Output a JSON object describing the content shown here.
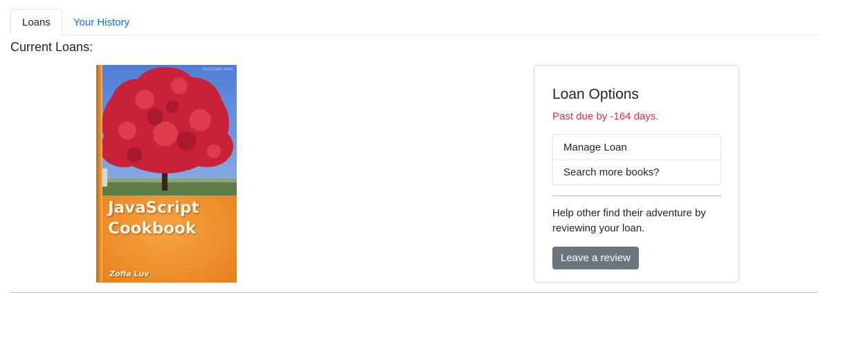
{
  "tabs": [
    {
      "label": "Loans",
      "active": true
    },
    {
      "label": "Your History",
      "active": false
    }
  ],
  "section_title": "Current Loans:",
  "book": {
    "title_line1": "JavaScript",
    "title_line2": "Cookbook",
    "author": "Zofia Luv",
    "watermark": "luv2code.com"
  },
  "loan_options": {
    "title": "Loan Options",
    "due_status": "Past due by -164 days.",
    "items": [
      {
        "label": "Manage Loan"
      },
      {
        "label": "Search more books?"
      }
    ],
    "review_text": "Help other find their adventure by reviewing your loan.",
    "review_button": "Leave a review"
  },
  "colors": {
    "link": "#0d6efd",
    "danger": "#dc3545",
    "secondary_button": "#6c757d"
  },
  "icons": []
}
